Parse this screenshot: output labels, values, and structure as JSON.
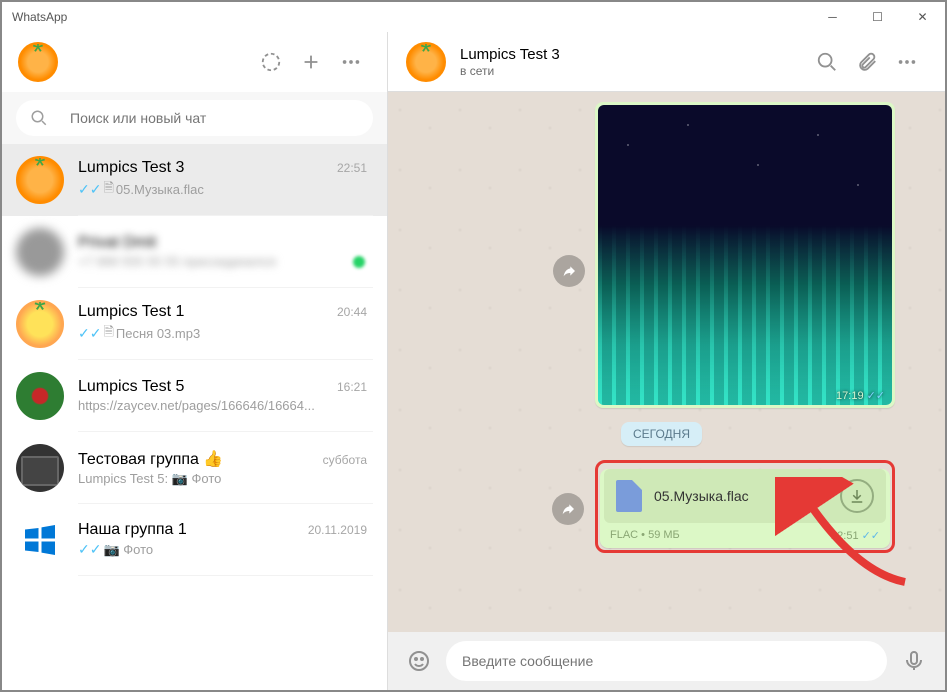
{
  "window": {
    "title": "WhatsApp"
  },
  "search": {
    "placeholder": "Поиск или новый чат"
  },
  "chats": [
    {
      "name": "Lumpics Test 3",
      "time": "22:51",
      "preview": "05.Музыка.flac",
      "checks": true,
      "doc": true,
      "avatar": "orange",
      "active": true
    },
    {
      "name": "Privat Dmit",
      "time": "",
      "preview": "+7 999 555 55 55 присоединился",
      "avatar": "blurred",
      "blur": true,
      "dot": true
    },
    {
      "name": "Lumpics Test 1",
      "time": "20:44",
      "preview": "Песня 03.mp3",
      "checks": true,
      "doc": true,
      "avatar": "yellow"
    },
    {
      "name": "Lumpics Test 5",
      "time": "16:21",
      "preview": "https://zaycev.net/pages/166646/16664...",
      "avatar": "green"
    },
    {
      "name": "Тестовая группа 👍",
      "time": "суббота",
      "preview": "Lumpics Test 5: 📷 Фото",
      "avatar": "pc"
    },
    {
      "name": "Наша группа 1",
      "time": "20.11.2019",
      "preview": "📷 Фото",
      "checks": true,
      "avatar": "win"
    }
  ],
  "conversation": {
    "title": "Lumpics Test 3",
    "subtitle": "в сети",
    "image_time": "17:19",
    "date_chip": "СЕГОДНЯ",
    "file": {
      "name": "05.Музыка.flac",
      "meta": "FLAC • 59 МБ",
      "time": "22:51"
    }
  },
  "composer": {
    "placeholder": "Введите сообщение"
  }
}
